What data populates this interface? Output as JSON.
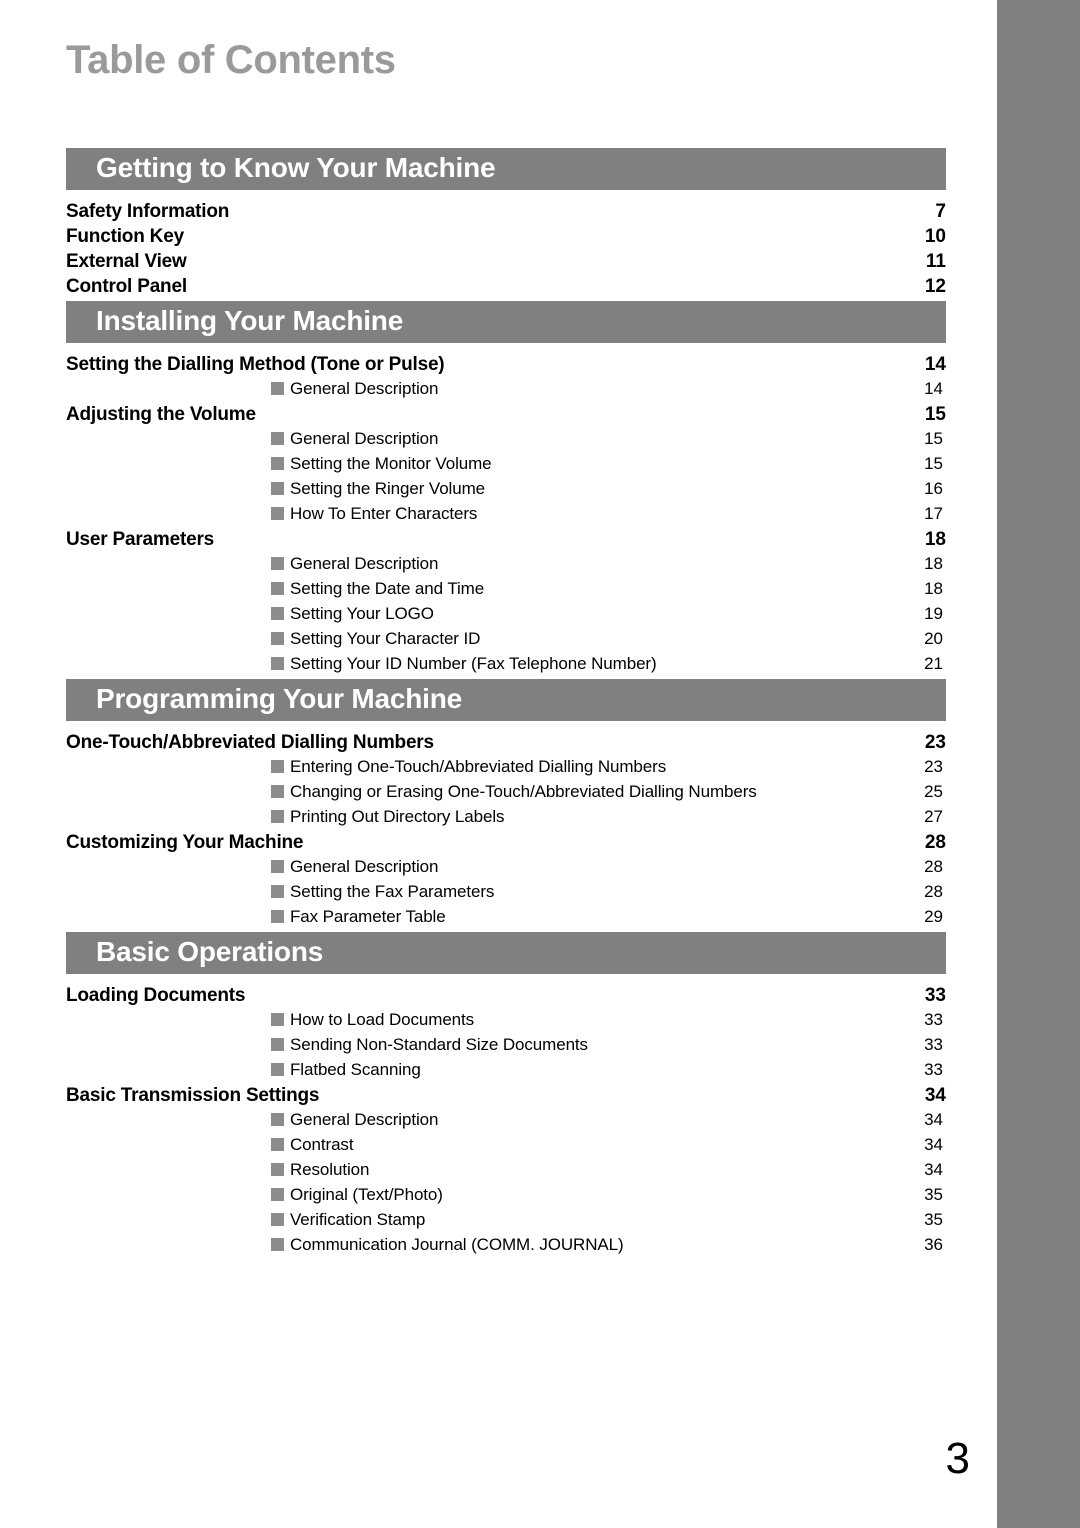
{
  "document": {
    "title": "Table of Contents",
    "folio": "3",
    "accent_gray": "#808080",
    "title_gray": "#9a9a9a",
    "bullet_gray": "#8c8c8c"
  },
  "sections": [
    {
      "heading": "Getting to Know Your Machine",
      "entries": [
        {
          "level": "main",
          "label": "Safety Information",
          "page": "7"
        },
        {
          "level": "main",
          "label": "Function Key",
          "page": "10"
        },
        {
          "level": "main",
          "label": "External View",
          "page": "11"
        },
        {
          "level": "main",
          "label": "Control Panel",
          "page": "12"
        }
      ]
    },
    {
      "heading": "Installing Your Machine",
      "entries": [
        {
          "level": "main",
          "label": "Setting the Dialling Method (Tone or Pulse)",
          "page": "14"
        },
        {
          "level": "sub",
          "label": "General Description",
          "page": "14"
        },
        {
          "level": "main",
          "label": "Adjusting the Volume",
          "page": "15"
        },
        {
          "level": "sub",
          "label": "General Description",
          "page": "15"
        },
        {
          "level": "sub",
          "label": "Setting the Monitor Volume",
          "page": "15"
        },
        {
          "level": "sub",
          "label": "Setting the Ringer Volume",
          "page": "16"
        },
        {
          "level": "sub",
          "label": "How To Enter Characters",
          "page": "17"
        },
        {
          "level": "main",
          "label": "User Parameters",
          "page": "18"
        },
        {
          "level": "sub",
          "label": "General Description",
          "page": "18"
        },
        {
          "level": "sub",
          "label": "Setting the Date and Time",
          "page": "18"
        },
        {
          "level": "sub",
          "label": "Setting Your LOGO",
          "page": "19"
        },
        {
          "level": "sub",
          "label": "Setting Your Character ID",
          "page": "20"
        },
        {
          "level": "sub",
          "label": "Setting Your ID Number (Fax Telephone Number)",
          "page": "21"
        }
      ]
    },
    {
      "heading": "Programming Your Machine",
      "entries": [
        {
          "level": "main",
          "label": "One-Touch/Abbreviated Dialling Numbers",
          "page": "23"
        },
        {
          "level": "sub",
          "label": "Entering One-Touch/Abbreviated Dialling Numbers",
          "page": "23"
        },
        {
          "level": "sub",
          "label": "Changing or Erasing One-Touch/Abbreviated Dialling Numbers",
          "page": "25"
        },
        {
          "level": "sub",
          "label": "Printing Out Directory Labels",
          "page": "27"
        },
        {
          "level": "main",
          "label": "Customizing Your Machine",
          "page": "28"
        },
        {
          "level": "sub",
          "label": "General Description",
          "page": "28"
        },
        {
          "level": "sub",
          "label": "Setting the Fax Parameters",
          "page": "28"
        },
        {
          "level": "sub",
          "label": "Fax Parameter Table",
          "page": "29"
        }
      ]
    },
    {
      "heading": "Basic Operations",
      "entries": [
        {
          "level": "main",
          "label": "Loading Documents",
          "page": "33"
        },
        {
          "level": "sub",
          "label": "How to Load Documents",
          "page": "33"
        },
        {
          "level": "sub",
          "label": "Sending Non-Standard Size Documents",
          "page": "33"
        },
        {
          "level": "sub",
          "label": "Flatbed Scanning",
          "page": "33"
        },
        {
          "level": "main",
          "label": "Basic Transmission Settings",
          "page": "34"
        },
        {
          "level": "sub",
          "label": "General Description",
          "page": "34"
        },
        {
          "level": "sub",
          "label": "Contrast",
          "page": "34"
        },
        {
          "level": "sub",
          "label": "Resolution",
          "page": "34"
        },
        {
          "level": "sub",
          "label": "Original (Text/Photo)",
          "page": "35"
        },
        {
          "level": "sub",
          "label": "Verification Stamp",
          "page": "35"
        },
        {
          "level": "sub",
          "label": "Communication Journal (COMM. JOURNAL)",
          "page": "36"
        }
      ]
    }
  ]
}
